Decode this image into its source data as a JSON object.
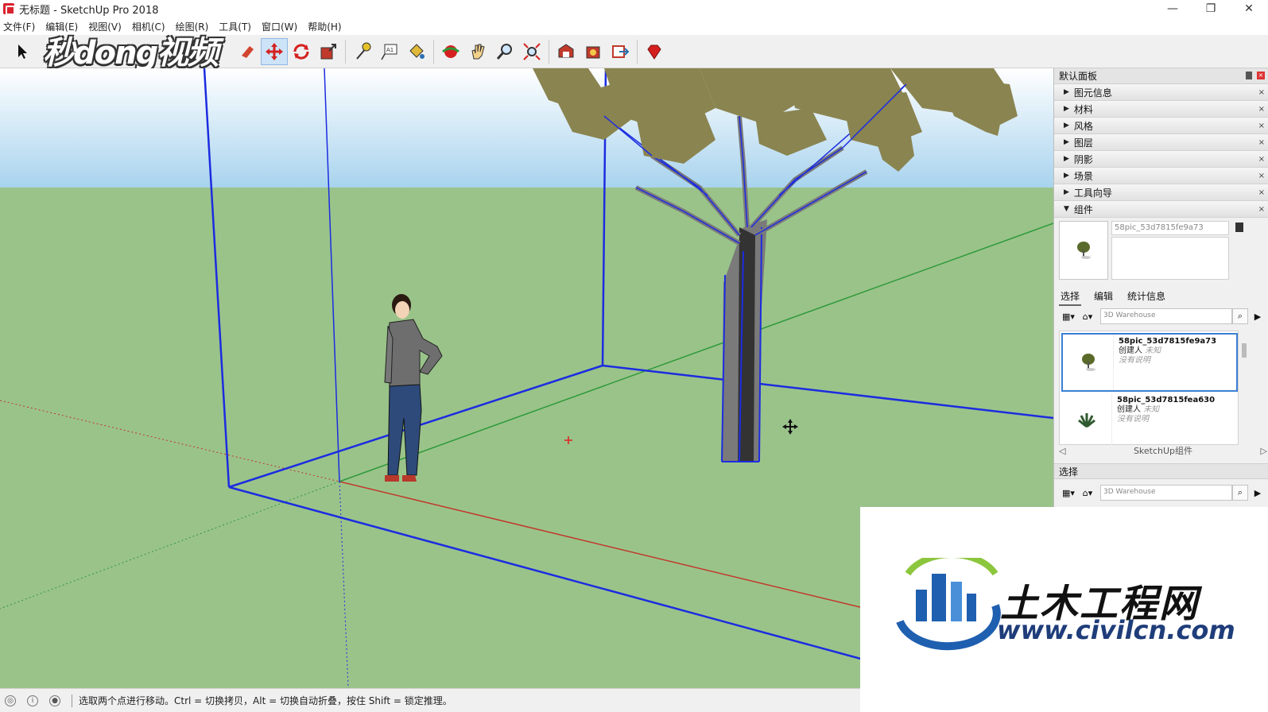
{
  "window": {
    "title": "无标题 - SketchUp Pro 2018",
    "controls": {
      "minimize": "—",
      "restore": "❐",
      "close": "✕"
    }
  },
  "menu": [
    "文件(F)",
    "编辑(E)",
    "视图(V)",
    "相机(C)",
    "绘图(R)",
    "工具(T)",
    "窗口(W)",
    "帮助(H)"
  ],
  "watermark_top": "秒dong视频",
  "toolbar": {
    "tools": [
      "select-tool",
      "paint-bucket-tool",
      "move-tool",
      "rotate-tool",
      "scale-tool",
      "tape-measure-tool",
      "text-tool",
      "paint-tool",
      "orbit-tool",
      "pan-tool",
      "zoom-tool",
      "zoom-extents-tool",
      "warehouse-tool",
      "extension-warehouse-tool",
      "share-model-tool",
      "ruby-tool"
    ],
    "active": "move-tool"
  },
  "panel": {
    "title": "默认面板",
    "trays": [
      "图元信息",
      "材料",
      "风格",
      "图层",
      "阴影",
      "场景",
      "工具向导"
    ],
    "open_tray": "组件",
    "component_name": "58pic_53d7815fe9a73",
    "tabs": [
      "选择",
      "编辑",
      "统计信息"
    ],
    "search_placeholder": "3D Warehouse",
    "items": [
      {
        "title": "58pic_53d7815fe9a73",
        "by_label": "创建人",
        "by_value": "未知",
        "desc": "没有说明"
      },
      {
        "title": "58pic_53d7815fea630",
        "by_label": "创建人",
        "by_value": "未知",
        "desc": "没有说明"
      }
    ],
    "collection": "SketchUp组件",
    "select_section": "选择",
    "search_placeholder2": "3D Warehouse"
  },
  "status": {
    "message": "选取两个点进行移动。Ctrl = 切换拷贝，Alt = 切换自动折叠，按住 Shift = 锁定推理。"
  },
  "logo": {
    "cn": "土木工程网",
    "url": "www.civilcn.com"
  },
  "colors": {
    "sky_top": "#ffffff",
    "sky_bottom": "#a8d3ee",
    "ground": "#9ac38a",
    "edge_blue": "#1c2ce0",
    "axis_red": "#c0392b",
    "axis_green": "#2e9a3a",
    "foliage": "#8a8450",
    "trunk": "#7a7a7a"
  }
}
